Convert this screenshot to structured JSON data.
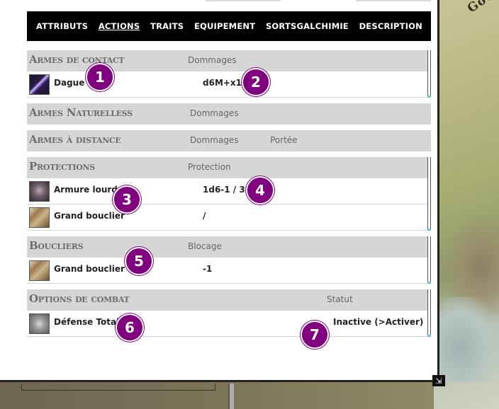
{
  "map_label": "Gou",
  "tabs": [
    {
      "label": "ATTRIBUTS"
    },
    {
      "label": "ACTIONS",
      "active": true
    },
    {
      "label": "TRAITS"
    },
    {
      "label": "EQUIPEMENT"
    },
    {
      "label": "SORTSGALCHIMIE"
    },
    {
      "label": "DESCRIPTION"
    }
  ],
  "melee": {
    "title": "Armes de contact",
    "col1": "Dommages",
    "rows": [
      {
        "name": "Dague",
        "value": "d6M+x1",
        "icon": "dagger-icon"
      }
    ]
  },
  "natural": {
    "title": "Armes Naturelless",
    "col1": "Dommages"
  },
  "ranged": {
    "title": "Armes à distance",
    "col1": "Dommages",
    "col2": "Portée"
  },
  "protections": {
    "title": "Protections",
    "col1": "Protection",
    "rows": [
      {
        "name": "Armure lourde",
        "value": "1d6-1 / 3",
        "icon": "armor-icon"
      },
      {
        "name": "Grand bouclier",
        "value": "/",
        "icon": "shield-icon"
      }
    ]
  },
  "shields": {
    "title": "Boucliers",
    "col1": "Blocage",
    "rows": [
      {
        "name": "Grand bouclier",
        "value": "-1",
        "icon": "shield-icon"
      }
    ]
  },
  "combat_options": {
    "title": "Options de combat",
    "col1": "Statut",
    "rows": [
      {
        "name": "Défense Totale",
        "value": "Inactive (>Activer)",
        "icon": "axes-icon"
      }
    ]
  },
  "badges": [
    "1",
    "2",
    "3",
    "4",
    "5",
    "6",
    "7"
  ],
  "colors": {
    "badge": "#800080",
    "header_bg": "#d6d6d6",
    "tab_bar": "#000000"
  }
}
